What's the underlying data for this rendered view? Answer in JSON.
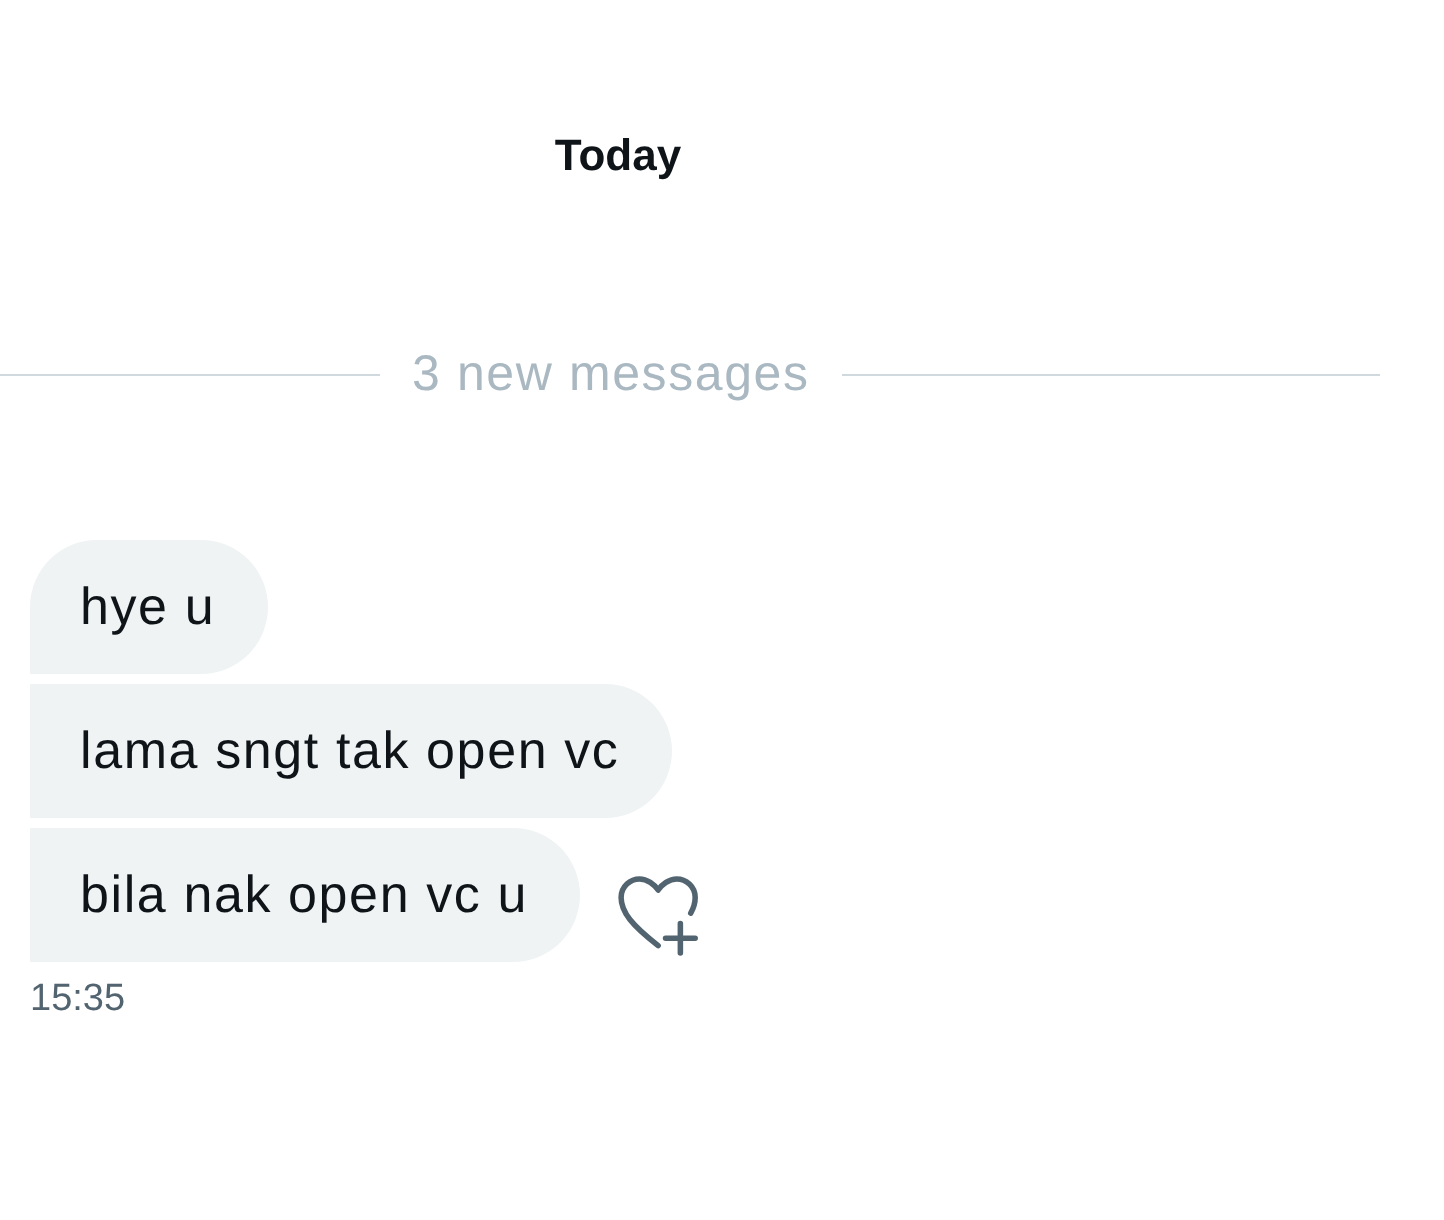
{
  "day_header": "Today",
  "new_messages_divider": "3 new messages",
  "messages": [
    {
      "text": "hye u",
      "react_button": false
    },
    {
      "text": "lama sngt tak open vc",
      "react_button": false
    },
    {
      "text": "bila nak open vc u",
      "react_button": true
    }
  ],
  "timestamp": "15:35"
}
